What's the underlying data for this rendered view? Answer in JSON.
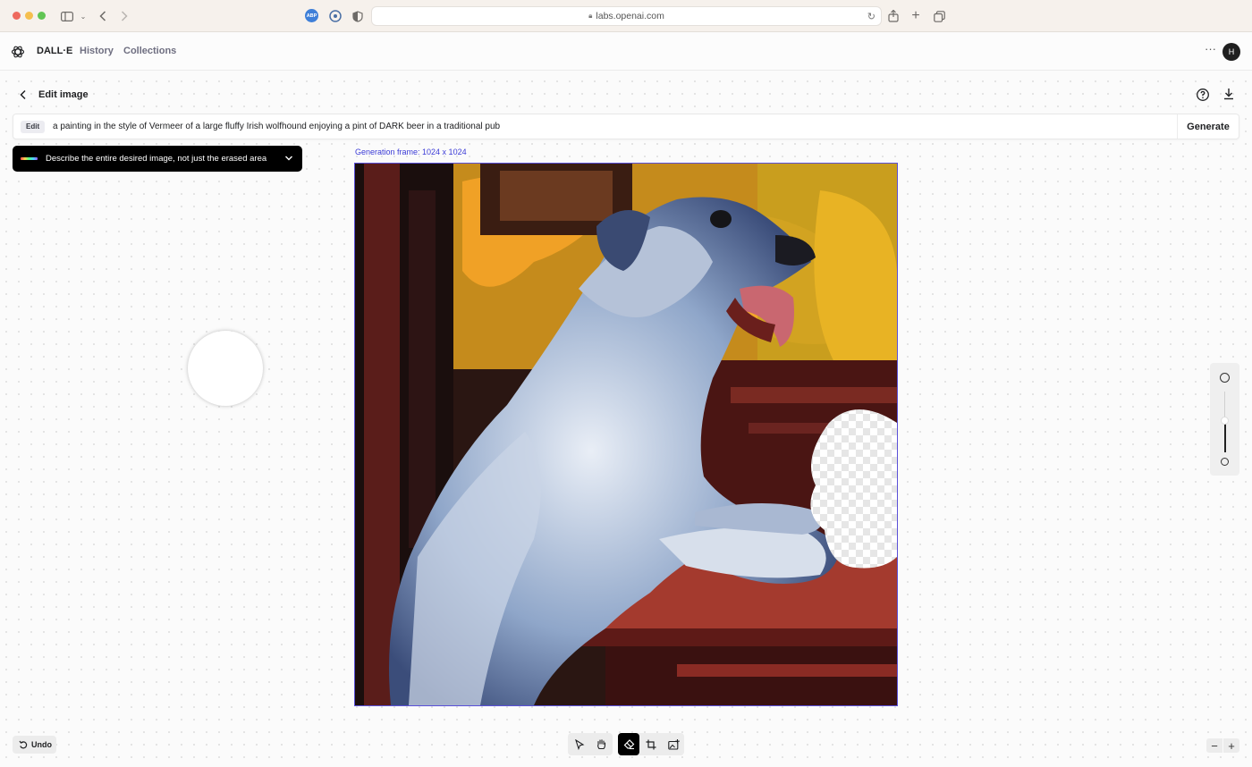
{
  "browser": {
    "url": "labs.openai.com",
    "extension_label": "ABP"
  },
  "header": {
    "brand": "DALL·E",
    "nav": [
      "History",
      "Collections"
    ],
    "more_label": "···",
    "avatar_initial": "H"
  },
  "editor": {
    "title": "Edit image",
    "mode_chip": "Edit",
    "prompt": "a painting in the style of Vermeer of a large fluffy Irish wolfhound enjoying a pint of DARK beer in a traditional pub",
    "generate_label": "Generate",
    "tip": "Describe the entire desired image, not just the erased area",
    "frame_label": "Generation frame: 1024 x 1024",
    "brush_size_level": 0.5,
    "accent_color": "#5a50d8"
  },
  "bottom": {
    "undo_label": "Undo",
    "tools": [
      "select-tool",
      "pan-tool",
      "eraser-tool",
      "crop-tool",
      "upload-image-tool"
    ],
    "active_tool": "eraser-tool",
    "zoom_out": "−",
    "zoom_in": "+"
  }
}
